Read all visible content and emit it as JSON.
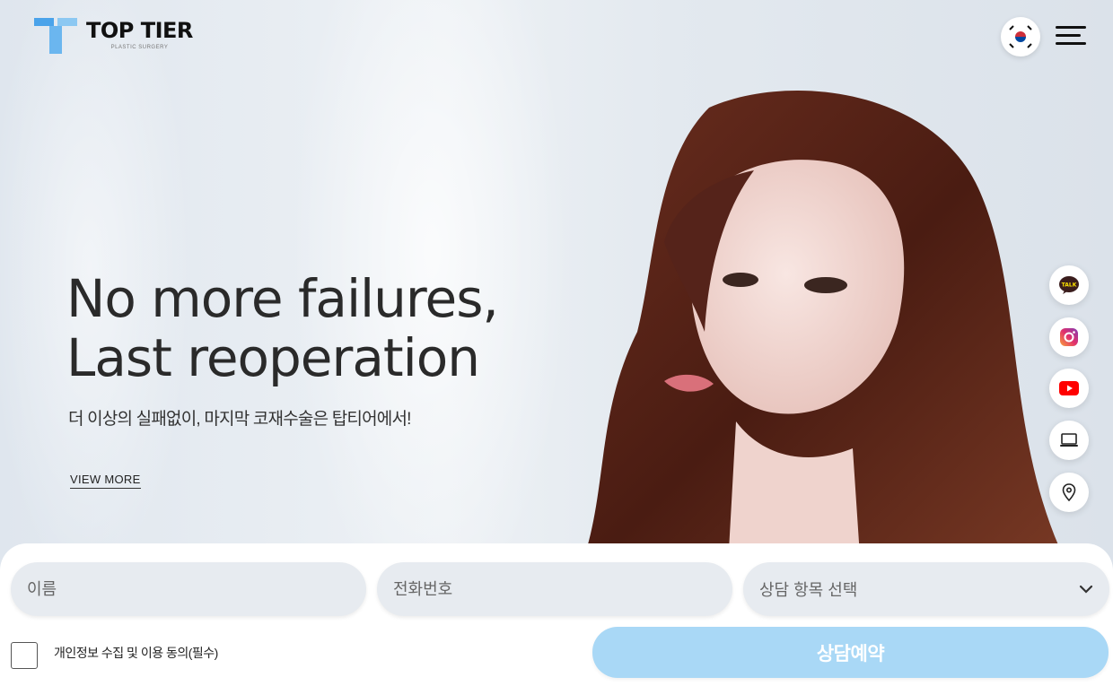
{
  "header": {
    "logo_name": "TOP TIER",
    "logo_sub": "PLASTIC SURGERY",
    "logo_color": "#4aa3ea"
  },
  "hero": {
    "headline_line1": "No more failures,",
    "headline_line2": "Last reoperation",
    "subline": "더 이상의 실패없이, 마지막 코재수술은 탑티어에서!",
    "view_more": "VIEW MORE"
  },
  "side_links": [
    {
      "name": "kakaotalk",
      "label": "TALK"
    },
    {
      "name": "instagram"
    },
    {
      "name": "youtube"
    },
    {
      "name": "blog"
    },
    {
      "name": "location"
    }
  ],
  "form": {
    "name_placeholder": "이름",
    "phone_placeholder": "전화번호",
    "consult_select": "상담 항목 선택",
    "agree_label": "개인정보 수집 및 이용 동의(필수)",
    "submit_label": "상담예약"
  },
  "colors": {
    "accent": "#4aa3ea",
    "submit_bg": "#a9d8f6",
    "field_bg": "#e7ebf0",
    "kakao": "#fae100",
    "youtube": "#ff0000"
  }
}
